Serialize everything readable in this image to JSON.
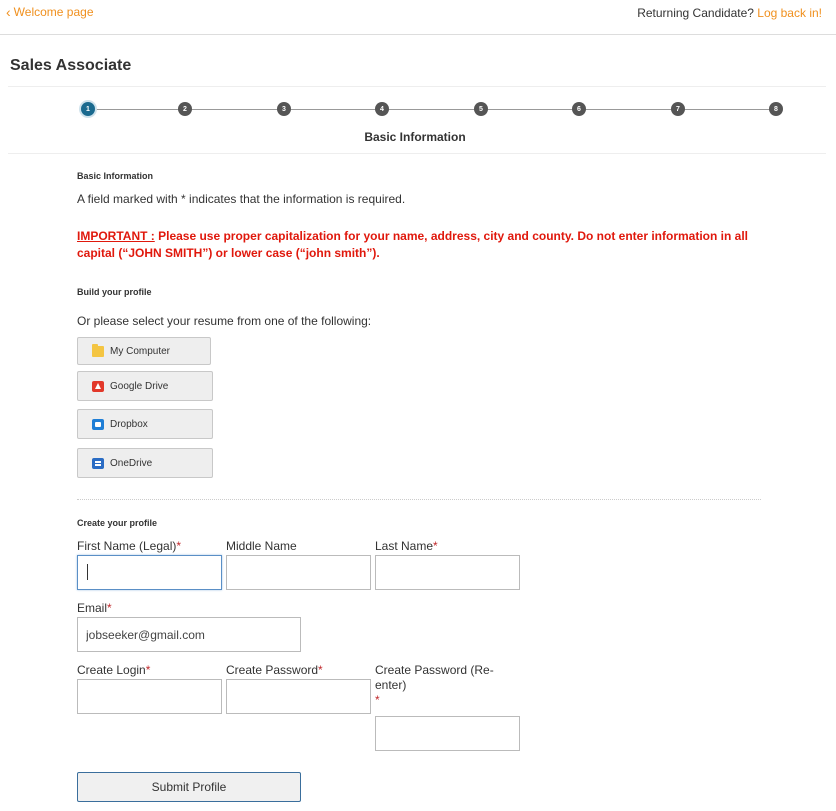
{
  "topbar": {
    "back_label": "Welcome page",
    "returning_text": "Returning Candidate?",
    "login_label": "Log back in!"
  },
  "job": {
    "title": "Sales Associate"
  },
  "stepper": {
    "steps": [
      "1",
      "2",
      "3",
      "4",
      "5",
      "6",
      "7",
      "8"
    ],
    "active_step": 1,
    "current_label": "Basic Information"
  },
  "basic_info": {
    "heading": "Basic Information",
    "required_note": "A field marked with * indicates that the information is required.",
    "important_label": "IMPORTANT :",
    "important_text": " Please use proper capitalization for your name, address, city and county.  Do not enter information in all capital (“JOHN SMITH”) or lower case (“john smith”)."
  },
  "build_profile": {
    "heading": "Build your profile",
    "resume_prompt": "Or please select your resume from one of the following:",
    "sources": [
      {
        "label": "My Computer",
        "icon": "folder-icon"
      },
      {
        "label": "Google Drive",
        "icon": "google-drive-icon"
      },
      {
        "label": "Dropbox",
        "icon": "dropbox-icon"
      },
      {
        "label": "OneDrive",
        "icon": "onedrive-icon"
      }
    ]
  },
  "create_profile": {
    "heading": "Create your profile",
    "first_name_label": "First Name (Legal)",
    "first_name_value": "",
    "middle_name_label": "Middle Name",
    "middle_name_value": "",
    "last_name_label": "Last Name",
    "last_name_value": "",
    "email_label": "Email",
    "email_value": "jobseeker@gmail.com",
    "login_label": "Create Login",
    "password_label": "Create Password",
    "password_reenter_label": "Create Password (Re-enter)",
    "required_mark": "*",
    "submit_label": "Submit Profile"
  },
  "colors": {
    "accent_orange": "#f0901e",
    "important_red": "#e0180c",
    "active_step": "#1a6a8f",
    "inactive_step": "#555555"
  }
}
